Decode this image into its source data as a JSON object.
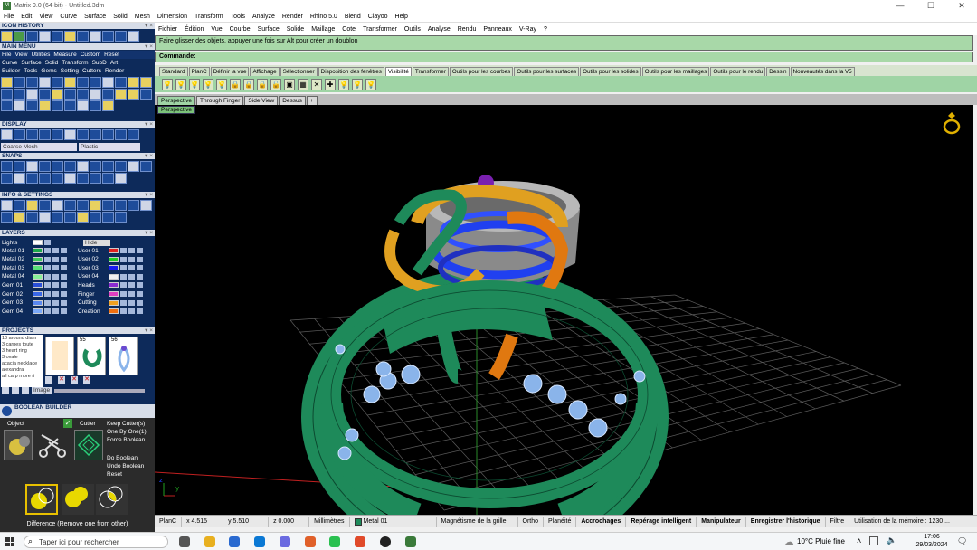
{
  "window": {
    "app_logo": "M",
    "title": "Matrix 9.0 (64-bit) - Untitled.3dm",
    "minimize": "—",
    "maximize": "☐",
    "close": "✕"
  },
  "menu": [
    "File",
    "Edit",
    "View",
    "Curve",
    "Surface",
    "Solid",
    "Mesh",
    "Dimension",
    "Transform",
    "Tools",
    "Analyze",
    "Render",
    "Rhino 5.0",
    "Blend",
    "Clayoo",
    "Help"
  ],
  "rhino_menu": [
    "Fichier",
    "Édition",
    "Vue",
    "Courbe",
    "Surface",
    "Solide",
    "Maillage",
    "Cote",
    "Transformer",
    "Outils",
    "Analyse",
    "Rendu",
    "Panneaux",
    "V-Ray",
    "?"
  ],
  "left": {
    "icon_history": "ICON HISTORY",
    "main_menu": "MAIN MENU",
    "main_menu_row1": [
      "File",
      "View",
      "Utilities",
      "Measure",
      "Custom",
      "Reset"
    ],
    "main_menu_row2": [
      "Curve",
      "Surface",
      "Solid",
      "Transform",
      "SubD",
      "Art"
    ],
    "main_menu_row3": [
      "Builder",
      "Tools",
      "Gems",
      "Setting",
      "Cutters",
      "Render"
    ],
    "display": "DISPLAY",
    "display_dropdowns": [
      "Coarse Mesh",
      "Plastic"
    ],
    "snaps": "SNAPS",
    "info_settings": "INFO & SETTINGS",
    "layers": "LAYERS",
    "lights_label": "Lights",
    "hide_label": "Hide",
    "layers_left": [
      {
        "name": "Metal 01",
        "color": "#1aa84a"
      },
      {
        "name": "Metal 02",
        "color": "#3cc85a"
      },
      {
        "name": "Metal 03",
        "color": "#58e078"
      },
      {
        "name": "Metal 04",
        "color": "#88f098"
      },
      {
        "name": "Gem 01",
        "color": "#2a4fd8"
      },
      {
        "name": "Gem 02",
        "color": "#3a68e8"
      },
      {
        "name": "Gem 03",
        "color": "#5a88f0"
      },
      {
        "name": "Gem 04",
        "color": "#7aa8f8"
      }
    ],
    "layers_right": [
      {
        "name": "User 01",
        "color": "#e02020"
      },
      {
        "name": "User 02",
        "color": "#20d020"
      },
      {
        "name": "User 03",
        "color": "#1a1af0"
      },
      {
        "name": "User 04",
        "color": "#f0f0f0"
      },
      {
        "name": "Heads",
        "color": "#8a2ad0"
      },
      {
        "name": "Finger",
        "color": "#e040c0"
      },
      {
        "name": "Cutting",
        "color": "#f0a020"
      },
      {
        "name": "Creation",
        "color": "#f07010"
      }
    ],
    "projects": "PROJECTS",
    "project_list": [
      "10 around diam",
      "3 carpes toute",
      "3 heart ring",
      "3 ovale",
      "acacia necklace",
      "alexandra",
      "all carp more ri"
    ],
    "thumb_numbers": [
      "55",
      "56"
    ],
    "image_btn": "Image",
    "boolean_builder": "BOOLEAN BUILDER",
    "object_label": "Object",
    "cutter_label": "Cutter",
    "bool_options": [
      "Keep Cutter(s)",
      "One By One(1)",
      "Force Boolean"
    ],
    "bool_actions": [
      "Do Boolean",
      "Undo Boolean",
      "Reset"
    ],
    "difference_caption": "Difference (Remove one from other)"
  },
  "command": {
    "history": "Faire glisser des objets, appuyer une fois sur Alt pour créer un doublon",
    "prompt_label": "Commande:",
    "value": ""
  },
  "toolbar_tabs": [
    "Standard",
    "PlanC",
    "Définir la vue",
    "Affichage",
    "Sélectionner",
    "Disposition des fenêtres",
    "Visibilité",
    "Transformer",
    "Outils pour les courbes",
    "Outils pour les surfaces",
    "Outils pour les solides",
    "Outils pour les maillages",
    "Outils pour le rendu",
    "Dessin",
    "Nouveautés dans la V5"
  ],
  "active_toolbar_tab": "Visibilité",
  "viewport_tabs": [
    "Perspective",
    "Through Finger",
    "Side View",
    "Dessus",
    "+"
  ],
  "viewport_label": "Perspective",
  "status": {
    "cplane": "PlanC",
    "x": "x 4.515",
    "y": "y 5.510",
    "z": "z 0.000",
    "units": "Millimètres",
    "layer": "Metal 01",
    "layer_color": "#1aa84a",
    "grid_snap": "Magnétisme de la grille",
    "ortho": "Ortho",
    "planar": "Planéité",
    "osnap": "Accrochages",
    "smarttrack": "Repérage intelligent",
    "gumball": "Manipulateur",
    "history": "Enregistrer l'historique",
    "filter": "Filtre",
    "memory": "Utilisation de la mémoire : 1230 ..."
  },
  "taskbar": {
    "search_placeholder": "Taper ici pour rechercher",
    "weather": "10°C  Pluie fine",
    "time": "17:06",
    "date": "29/03/2024"
  },
  "colors": {
    "ring_green": "#1e8a5a",
    "orange": "#e07810",
    "gold": "#e0a020",
    "blue": "#2040f0",
    "purple": "#7a20b0",
    "gray": "#9a9a9a",
    "gem": "#8ab4ea"
  }
}
